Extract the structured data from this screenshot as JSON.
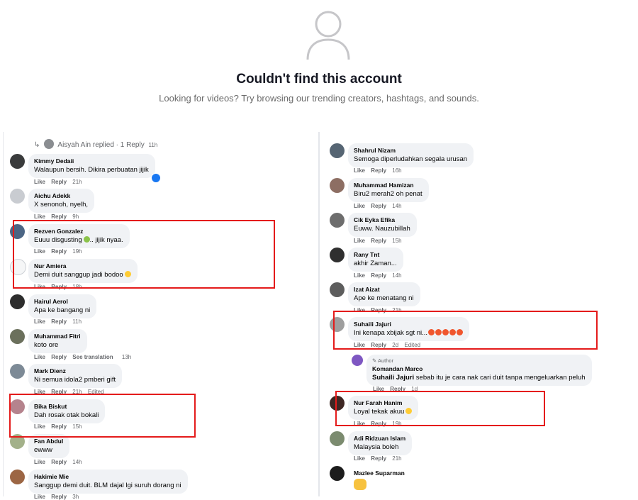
{
  "header": {
    "title": "Couldn't find this account",
    "subtitle": "Looking for videos? Try browsing our trending creators, hashtags, and sounds."
  },
  "left": {
    "reply_summary": {
      "arrow": "↳",
      "text": "Aisyah Ain replied · 1 Reply",
      "time": "11h"
    },
    "comments": [
      {
        "name": "Kimmy Dedaii",
        "text": "Walaupun bersih. Dikira perbuatan jijik",
        "actions": [
          "Like",
          "Reply"
        ],
        "time": "21h"
      },
      {
        "name": "Aichu Adekk",
        "text": "X senonoh, nyelh,",
        "actions": [
          "Like",
          "Reply"
        ],
        "time": "9h"
      },
      {
        "name": "Rezven Gonzalez",
        "text": "Euuu disgusting",
        "text2": ".. jijik nyaa.",
        "actions": [
          "Like",
          "Reply"
        ],
        "time": "19h"
      },
      {
        "name": "Nur Amiera",
        "text": "Demi duit sanggup jadi bodoo",
        "actions": [
          "Like",
          "Reply"
        ],
        "time": "18h"
      },
      {
        "name": "Hairul Aerol",
        "text": "Apa ke bangang ni",
        "actions": [
          "Like",
          "Reply"
        ],
        "time": "11h"
      },
      {
        "name": "Muhammad Fitri",
        "text": "koto ore",
        "actions": [
          "Like",
          "Reply",
          "See translation"
        ],
        "time": "13h"
      },
      {
        "name": "Mark Dienz",
        "text": "Ni semua idola2 pmberi gift",
        "actions": [
          "Like",
          "Reply"
        ],
        "time": "21h",
        "edited": "Edited"
      },
      {
        "name": "Bika Biskut",
        "text": "Dah rosak otak bokali",
        "actions": [
          "Like",
          "Reply"
        ],
        "time": "15h"
      },
      {
        "name": "Fan Abdul",
        "text": "ewww",
        "actions": [
          "Like",
          "Reply"
        ],
        "time": "14h"
      },
      {
        "name": "Hakimie Mie",
        "text": "Sanggup demi duit. BLM dajal lgi suruh dorang ni",
        "actions": [
          "Like",
          "Reply"
        ],
        "time": "3h"
      }
    ]
  },
  "right": {
    "comments": [
      {
        "name": "Shahrul Nizam",
        "text": "Semoga diperludahkan segala urusan",
        "actions": [
          "Like",
          "Reply"
        ],
        "time": "16h"
      },
      {
        "name": "Muhammad Hamizan",
        "text": "Biru2 merah2 oh penat",
        "actions": [
          "Like",
          "Reply"
        ],
        "time": "14h"
      },
      {
        "name": "Cik Eyka Efika",
        "text": "Euww. Nauzubillah",
        "actions": [
          "Like",
          "Reply"
        ],
        "time": "15h"
      },
      {
        "name": "Rany Tnt",
        "text": "akhir Zaman...",
        "actions": [
          "Like",
          "Reply"
        ],
        "time": "14h"
      },
      {
        "name": "Izat Aizat",
        "text": "Ape ke menatang ni",
        "actions": [
          "Like",
          "Reply"
        ],
        "time": "21h"
      },
      {
        "name": "Suhaili Jajuri",
        "text": "Ini kenapa xbijak sgt ni...",
        "actions": [
          "Like",
          "Reply"
        ],
        "time": "2d",
        "edited": "Edited"
      },
      {
        "name": "Nur Farah Hanim",
        "text": "Loyal tekak akuu",
        "actions": [
          "Like",
          "Reply"
        ],
        "time": "19h"
      },
      {
        "name": "Adi Ridzuan Islam",
        "text": "Malaysia boleh",
        "actions": [
          "Like",
          "Reply"
        ],
        "time": "21h"
      },
      {
        "name": "Mazlee Suparman",
        "text": "",
        "actions": [],
        "time": ""
      }
    ],
    "reply": {
      "author_tag": "Author",
      "name": "Komandan Marco",
      "mention": "Suhaili Jajuri",
      "text": "sebab itu je cara nak cari duit tanpa mengeluarkan peluh",
      "actions": [
        "Like",
        "Reply"
      ],
      "time": "1d"
    }
  },
  "colors": {
    "highlight": "#e41b1b",
    "bubble": "#f0f2f5",
    "meta": "#65676b"
  }
}
